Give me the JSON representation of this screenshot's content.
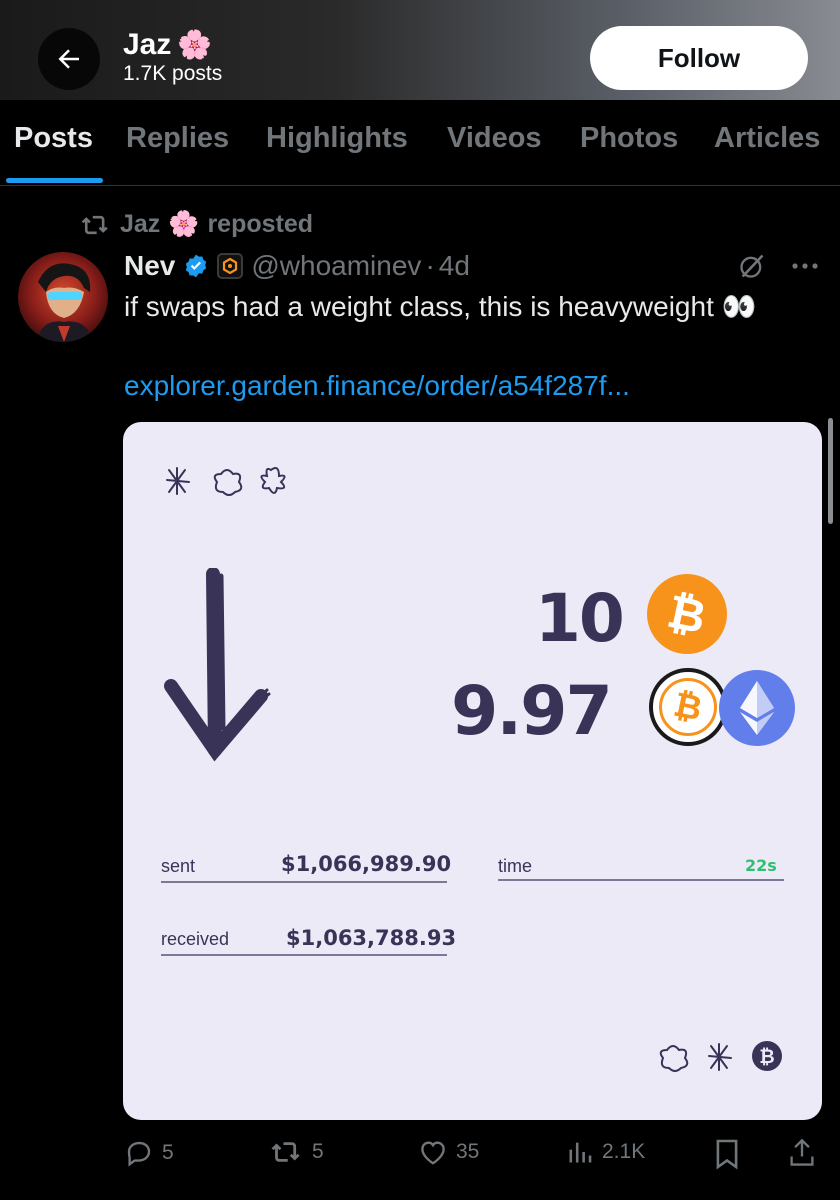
{
  "header": {
    "title": "Jaz",
    "title_emoji": "🌸",
    "post_count": "1.7K posts",
    "follow_label": "Follow"
  },
  "tabs": [
    {
      "label": "Posts",
      "active": true
    },
    {
      "label": "Replies",
      "active": false
    },
    {
      "label": "Highlights",
      "active": false
    },
    {
      "label": "Videos",
      "active": false
    },
    {
      "label": "Photos",
      "active": false
    },
    {
      "label": "Articles",
      "active": false
    }
  ],
  "repost": {
    "user": "Jaz",
    "emoji": "🌸",
    "label": "reposted"
  },
  "post": {
    "name": "Nev",
    "handle": "@whoaminev",
    "separator": "·",
    "time": "4d",
    "text": "if swaps had a weight class, this is heavyweight",
    "text_emoji": "👀",
    "link": "explorer.garden.finance/order/a54f287f...",
    "card": {
      "amount_top": "10",
      "amount_bottom": "9.97",
      "sent_label": "sent",
      "sent_value": "$1,066,989.90",
      "received_label": "received",
      "received_value": "$1,063,788.93",
      "time_label": "time",
      "time_value": "22s",
      "time_color": "#2fbf71",
      "bitcoin_color": "#f7931a",
      "ethereum_color": "#627eea",
      "ink_color": "#3a3358"
    }
  },
  "actions": {
    "replies": "5",
    "reposts": "5",
    "likes": "35",
    "views": "2.1K"
  },
  "colors": {
    "accent": "#1d9bf0",
    "muted": "#71767b",
    "background": "#000000"
  }
}
